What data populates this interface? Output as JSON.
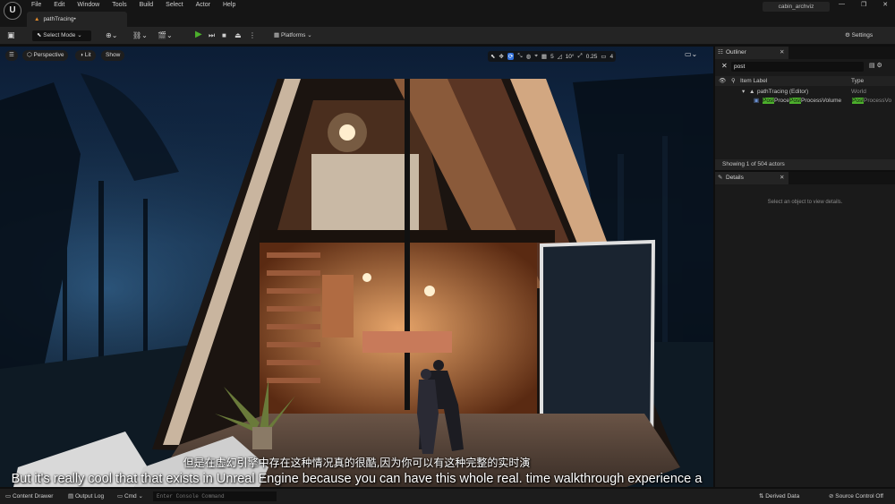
{
  "app": {
    "logo": "U",
    "menu": [
      "File",
      "Edit",
      "Window",
      "Tools",
      "Build",
      "Select",
      "Actor",
      "Help"
    ],
    "project_name": "cabin_archviz",
    "window_buttons": [
      "—",
      "❐",
      "✕"
    ]
  },
  "tabs": [
    {
      "label": "pathTracing•"
    }
  ],
  "toolbar": {
    "select_mode": "Select Mode",
    "platforms": "Platforms",
    "settings": "Settings"
  },
  "viewport": {
    "perspective": "Perspective",
    "lit": "Lit",
    "show": "Show",
    "grid_value": "5",
    "rotation_value": "10°",
    "scale_value": "0.25",
    "camera_speed": "4"
  },
  "subtitle": {
    "chinese": "但是在虚幻引擎中存在这种情况真的很酷,因为你可以有这种完整的实时演",
    "english": "But it's really cool that that exists in Unreal Engine because you can have this whole real. time walkthrough experience a"
  },
  "outliner": {
    "title": "Outliner",
    "search_value": "post",
    "col_label": "Item Label",
    "col_type": "Type",
    "rows": [
      {
        "label": "pathTracing (Editor)",
        "type": "World"
      },
      {
        "label_parts": [
          "Post",
          "Proce",
          "Post",
          "ProcessVolume"
        ],
        "type_parts": [
          "Post",
          "ProcessVo"
        ]
      }
    ],
    "status": "Showing 1 of 504 actors"
  },
  "details": {
    "title": "Details",
    "empty_text": "Select an object to view details."
  },
  "bottom": {
    "content_drawer": "Content Drawer",
    "output_log": "Output Log",
    "cmd": "Cmd",
    "console_placeholder": "Enter Console Command",
    "derived_data": "Derived Data",
    "source_control": "Source Control Off"
  },
  "colors": {
    "accent_green": "#4caf2c",
    "accent_blue": "#2f6ed8",
    "panel_bg": "#1a1a1a"
  }
}
